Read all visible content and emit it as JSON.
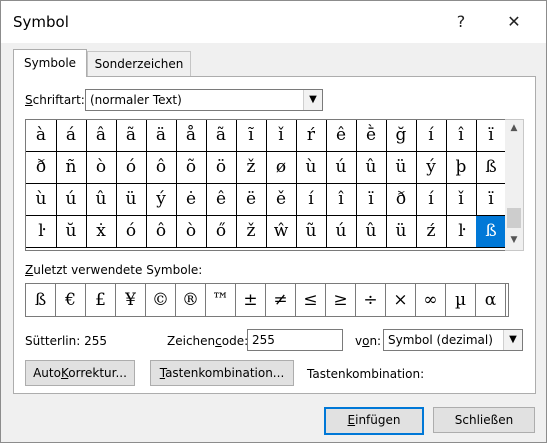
{
  "window": {
    "title": "Symbol",
    "help_label": "?",
    "close_label": "✕"
  },
  "tabs": [
    {
      "label": "Symbole",
      "active": true
    },
    {
      "label": "Sonderzeichen",
      "active": false
    }
  ],
  "font_label": "Schriftart:",
  "font_label_pre": "",
  "font_label_mnemonic": "S",
  "font_label_post": "chriftart:",
  "font_value": "(normaler Text)",
  "dropdown_icon": "▼",
  "symbol_grid": [
    [
      "à",
      "á",
      "â",
      "ã",
      "ä",
      "å",
      "ã",
      "ĩ",
      "ǐ",
      "ŕ",
      "ê",
      "ḕ",
      "ğ",
      "í",
      "î",
      "ï"
    ],
    [
      "ð",
      "ñ",
      "ò",
      "ó",
      "ô",
      "õ",
      "ö",
      "ž",
      "ø",
      "ù",
      "ú",
      "û",
      "ü",
      "ý",
      "þ",
      "ß"
    ],
    [
      "ù",
      "ú",
      "û",
      "ü",
      "ý",
      "ė",
      "ê",
      "ë",
      "ě",
      "í",
      "î",
      "ï",
      "ð",
      "í",
      "ǐ",
      "ï"
    ],
    [
      "ŀ",
      "ŭ",
      "ẋ",
      "ó",
      "ô",
      "ò",
      "ő",
      "ž",
      "ŵ",
      "ũ",
      "ú",
      "û",
      "ü",
      "ź",
      "ŀ",
      "ß"
    ]
  ],
  "selected_cell": {
    "row": 3,
    "col": 15
  },
  "scroll_up_icon": "▲",
  "scroll_down_icon": "▼",
  "recent_label_pre": "",
  "recent_label_mnemonic": "Z",
  "recent_label_post": "uletzt verwendete Symbole:",
  "recent_symbols": [
    "ß",
    "€",
    "£",
    "¥",
    "©",
    "®",
    "™",
    "±",
    "≠",
    "≤",
    "≥",
    "÷",
    "×",
    "∞",
    "µ",
    "α"
  ],
  "char_name": "Sütterlin: 255",
  "code_label_pre": "Zeichen",
  "code_label_mnemonic": "c",
  "code_label_post": "ode:",
  "code_value": "255",
  "from_label_pre": "v",
  "from_label_mnemonic": "o",
  "from_label_post": "n:",
  "from_value": "Symbol (dezimal)",
  "autocorrect_pre": "Auto",
  "autocorrect_mnemonic": "K",
  "autocorrect_post": "orrektur...",
  "shortcut_btn_pre": "",
  "shortcut_btn_mnemonic": "T",
  "shortcut_btn_post": "astenkombination...",
  "shortcut_label": "Tastenkombination:",
  "insert_pre": "",
  "insert_mnemonic": "E",
  "insert_post": "infügen",
  "close_button": "Schließen"
}
